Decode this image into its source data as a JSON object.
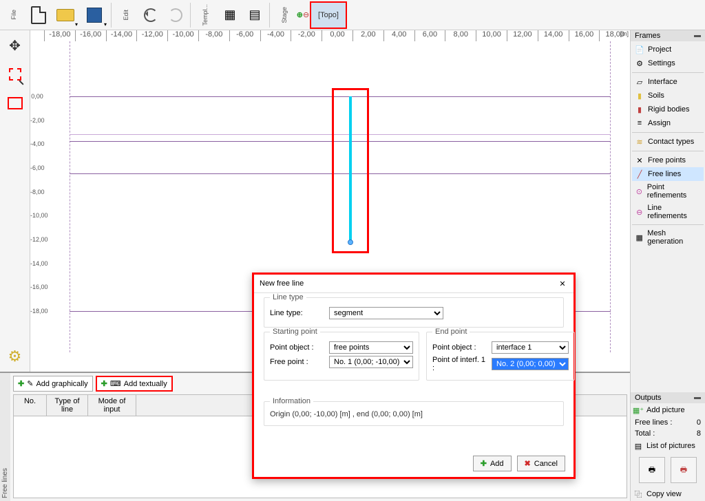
{
  "topbar": {
    "file_label": "File",
    "edit_label": "Edit",
    "templ_label": "Templ...",
    "stage_label": "Stage",
    "topo_label": "[Topo]"
  },
  "ruler": {
    "x": [
      "-18,00",
      "-16,00",
      "-14,00",
      "-12,00",
      "-10,00",
      "-8,00",
      "-6,00",
      "-4,00",
      "-2,00",
      "0,00",
      "2,00",
      "4,00",
      "6,00",
      "8,00",
      "10,00",
      "12,00",
      "14,00",
      "16,00",
      "18,00"
    ],
    "y": [
      "0,00",
      "-2,00",
      "-4,00",
      "-6,00",
      "-8,00",
      "-10,00",
      "-12,00",
      "-14,00",
      "-16,00",
      "-18,00"
    ],
    "unit": "[m]"
  },
  "rightpanel": {
    "frames_title": "Frames",
    "items1": [
      "Project",
      "Settings"
    ],
    "items2": [
      "Interface",
      "Soils",
      "Rigid bodies",
      "Assign"
    ],
    "items3": [
      "Contact types"
    ],
    "items4": [
      "Free points",
      "Free lines",
      "Point refinements",
      "Line refinements"
    ],
    "items5": [
      "Mesh generation"
    ],
    "outputs_title": "Outputs",
    "add_picture": "Add picture",
    "free_lines_label": "Free lines :",
    "free_lines_count": "0",
    "total_label": "Total :",
    "total_count": "8",
    "list_pictures": "List of pictures",
    "copy_view": "Copy view"
  },
  "bottom": {
    "vlabel": "Free lines",
    "add_graphically": "Add graphically",
    "add_textually": "Add textually",
    "col_no": "No.",
    "col_type": "Type of line",
    "col_mode": "Mode of input"
  },
  "dialog": {
    "title": "New free line",
    "line_type_legend": "Line type",
    "line_type_label": "Line type:",
    "line_type_value": "segment",
    "starting_legend": "Starting point",
    "end_legend": "End point",
    "point_object_label": "Point object :",
    "start_point_object": "free points",
    "free_point_label": "Free point :",
    "free_point_value": "No.  1 (0,00; -10,00)",
    "end_point_object": "interface 1",
    "point_interf_label": "Point of interf. 1 :",
    "point_interf_value": "No.  2 (0,00; 0,00)",
    "info_legend": "Information",
    "info_text": "Origin (0,00; -10,00) [m] ,  end (0,00; 0,00) [m]",
    "add_btn": "Add",
    "cancel_btn": "Cancel"
  }
}
